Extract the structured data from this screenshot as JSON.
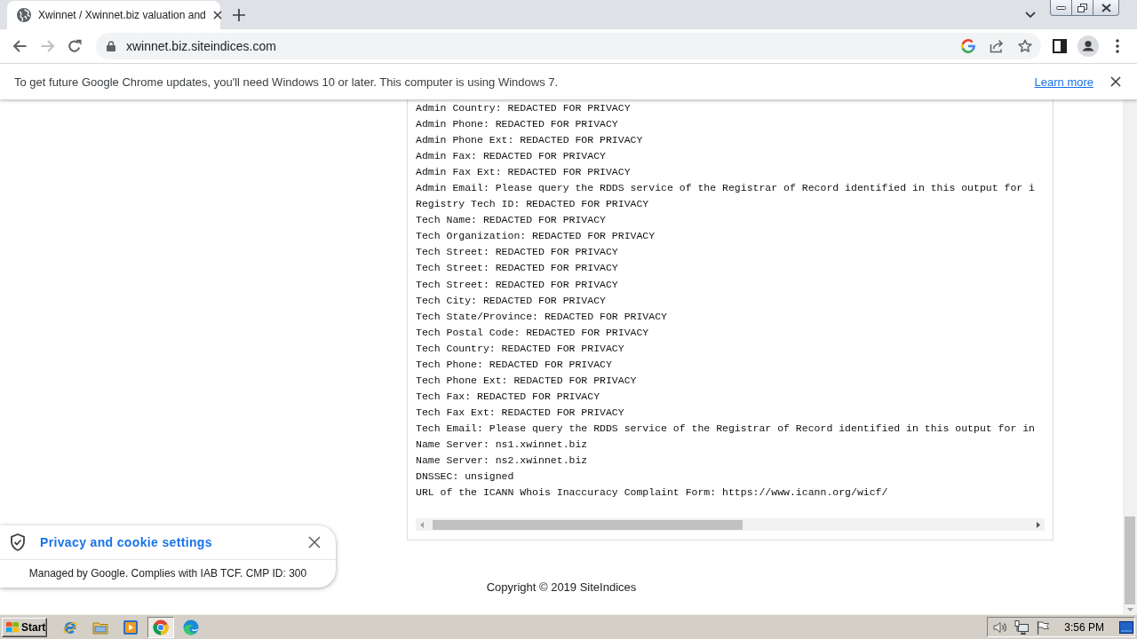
{
  "browser": {
    "tabs": [
      {
        "title": "Xwinnet / Xwinnet.biz valuation and",
        "selected": true
      }
    ],
    "nav_buttons": [
      {
        "kind": "back",
        "disabled": false
      },
      {
        "kind": "forward",
        "disabled": true
      },
      {
        "kind": "reload",
        "disabled": false
      }
    ],
    "address": "xwinnet.biz.siteindices.com"
  },
  "infobar": {
    "message": "To get future Google Chrome updates, you'll need Windows 10 or later. This computer is using Windows 7.",
    "link": "Learn more"
  },
  "whois": {
    "lines": [
      "Admin Country: REDACTED FOR PRIVACY",
      "Admin Phone: REDACTED FOR PRIVACY",
      "Admin Phone Ext: REDACTED FOR PRIVACY",
      "Admin Fax: REDACTED FOR PRIVACY",
      "Admin Fax Ext: REDACTED FOR PRIVACY",
      "Admin Email: Please query the RDDS service of the Registrar of Record identified in this output for i",
      "Registry Tech ID: REDACTED FOR PRIVACY",
      "Tech Name: REDACTED FOR PRIVACY",
      "Tech Organization: REDACTED FOR PRIVACY",
      "Tech Street: REDACTED FOR PRIVACY",
      "Tech Street: REDACTED FOR PRIVACY",
      "Tech Street: REDACTED FOR PRIVACY",
      "Tech City: REDACTED FOR PRIVACY",
      "Tech State/Province: REDACTED FOR PRIVACY",
      "Tech Postal Code: REDACTED FOR PRIVACY",
      "Tech Country: REDACTED FOR PRIVACY",
      "Tech Phone: REDACTED FOR PRIVACY",
      "Tech Phone Ext: REDACTED FOR PRIVACY",
      "Tech Fax: REDACTED FOR PRIVACY",
      "Tech Fax Ext: REDACTED FOR PRIVACY",
      "Tech Email: Please query the RDDS service of the Registrar of Record identified in this output for in",
      "Name Server: ns1.xwinnet.biz",
      "Name Server: ns2.xwinnet.biz",
      "DNSSEC: unsigned",
      "URL of the ICANN Whois Inaccuracy Complaint Form: https://www.icann.org/wicf/"
    ]
  },
  "footer": {
    "copyright": "Copyright © 2019 SiteIndices"
  },
  "cookie_banner": {
    "title": "Privacy and cookie settings",
    "note": "Managed by Google. Complies with IAB TCF. CMP ID: 300"
  },
  "taskbar": {
    "start": "Start",
    "apps": [
      {
        "kind": "ie",
        "selected": false
      },
      {
        "kind": "explorer",
        "selected": false
      },
      {
        "kind": "media",
        "selected": false
      },
      {
        "kind": "chrome",
        "selected": true
      },
      {
        "kind": "edge",
        "selected": false
      }
    ],
    "clock": "3:56 PM"
  }
}
